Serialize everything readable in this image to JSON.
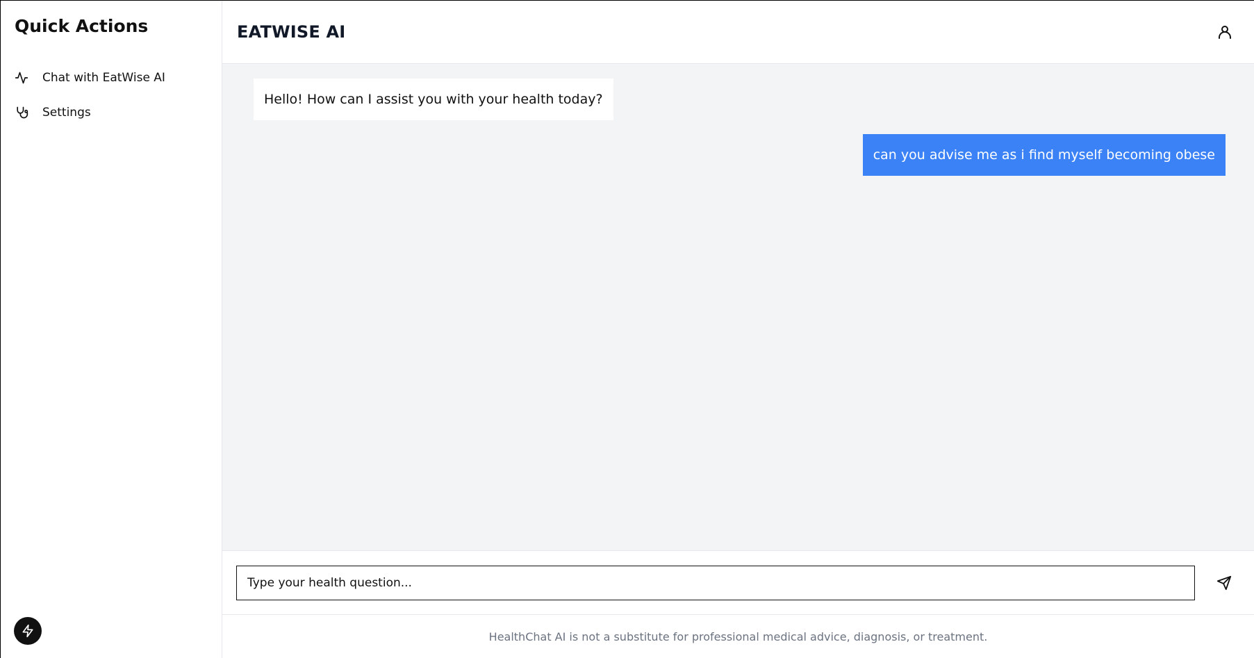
{
  "sidebar": {
    "title": "Quick Actions",
    "items": [
      {
        "label": "Chat with EatWise AI",
        "icon": "activity-icon"
      },
      {
        "label": "Settings",
        "icon": "stethoscope-icon"
      }
    ],
    "floating_button_icon": "bolt-icon"
  },
  "header": {
    "title": "EATWISE AI",
    "user_icon": "user-icon"
  },
  "chat": {
    "messages": [
      {
        "role": "assistant",
        "text": "Hello! How can I assist you with your health today?"
      },
      {
        "role": "user",
        "text": "can you advise me as i find myself becoming obese"
      }
    ]
  },
  "composer": {
    "placeholder": "Type your health question...",
    "value": "",
    "send_icon": "send-icon"
  },
  "footer": {
    "disclaimer": "HealthChat AI is not a substitute for professional medical advice, diagnosis, or treatment."
  },
  "colors": {
    "user_bubble": "#3b82f6",
    "chat_background": "#f3f4f6",
    "footer_text": "#6b7280"
  }
}
